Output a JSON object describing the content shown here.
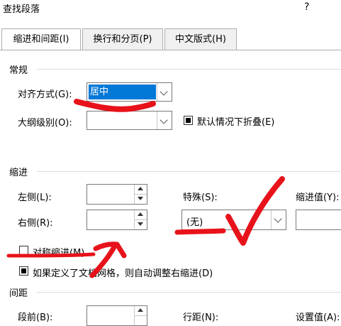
{
  "window": {
    "title": "查找段落",
    "help": "?"
  },
  "tabs": [
    {
      "label": "缩进和间距(I)",
      "active": true
    },
    {
      "label": "换行和分页(P)",
      "active": false
    },
    {
      "label": "中文版式(H)",
      "active": false
    }
  ],
  "general": {
    "heading": "常规",
    "alignment_label": "对齐方式(G):",
    "alignment_value": "居中",
    "outline_label": "大纲级别(O):",
    "outline_value": "",
    "collapse_checkbox_label": "默认情况下折叠(E)",
    "collapse_checked": true
  },
  "indent": {
    "heading": "缩进",
    "left_label": "左侧(L):",
    "left_value": "",
    "right_label": "右侧(R):",
    "right_value": "",
    "special_label": "特殊(S):",
    "special_value": "(无)",
    "indent_value_label": "缩进值(Y):",
    "indent_value": "",
    "mirror_label": "对称缩进(M)",
    "mirror_checked": false,
    "grid_label": "如果定义了文档网格，则自动调整右缩进(D)",
    "grid_checked": true
  },
  "spacing": {
    "heading": "间距",
    "before_label": "段前(B):",
    "line_spacing_label": "行距(N):",
    "at_label": "设置值(A):"
  },
  "colors": {
    "selection": "#0078d7",
    "ink": "#e8121a"
  }
}
